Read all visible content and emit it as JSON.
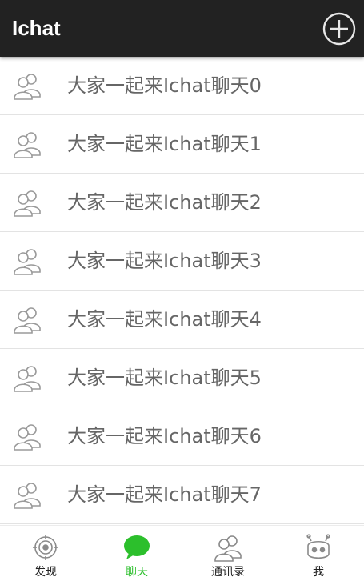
{
  "app": {
    "title": "Ichat"
  },
  "chats": [
    {
      "name": "大家一起来Ichat聊天0"
    },
    {
      "name": "大家一起来Ichat聊天1"
    },
    {
      "name": "大家一起来Ichat聊天2"
    },
    {
      "name": "大家一起来Ichat聊天3"
    },
    {
      "name": "大家一起来Ichat聊天4"
    },
    {
      "name": "大家一起来Ichat聊天5"
    },
    {
      "name": "大家一起来Ichat聊天6"
    },
    {
      "name": "大家一起来Ichat聊天7"
    }
  ],
  "tabs": [
    {
      "label": "发现",
      "icon": "compass-icon",
      "active": false
    },
    {
      "label": "聊天",
      "icon": "chat-bubble-icon",
      "active": true
    },
    {
      "label": "通讯录",
      "icon": "contacts-icon",
      "active": false
    },
    {
      "label": "我",
      "icon": "robot-face-icon",
      "active": false
    }
  ],
  "colors": {
    "appbar": "#222222",
    "active_tab": "#2cbf2c",
    "row_text": "#666666",
    "icon_gray": "#999999"
  }
}
